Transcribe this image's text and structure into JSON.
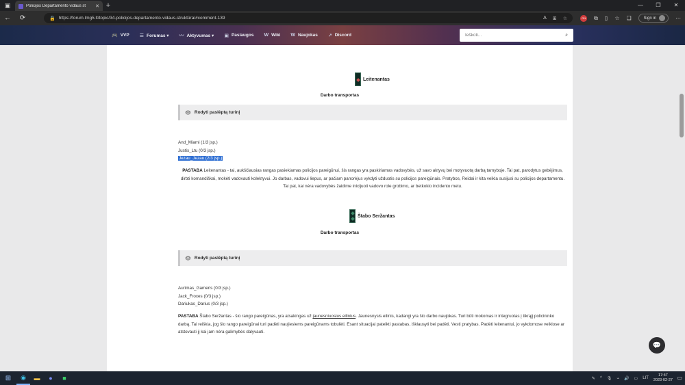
{
  "browser": {
    "tab_title": "Policijos Departamento vidaus st",
    "url": "https://forum.lmg5.lt/topic/34-policijos-departamento-vidaus-struktūra/#comment-139",
    "sign_in_label": "Sign in"
  },
  "nav": {
    "items": [
      {
        "icon": "gamepad-icon",
        "label": "VVP"
      },
      {
        "icon": "list-icon",
        "label": "Forumas ▾"
      },
      {
        "icon": "pulse-icon",
        "label": "Aktyvumas ▾"
      },
      {
        "icon": "tag-icon",
        "label": "Paslaugos"
      },
      {
        "icon": "wiki-icon",
        "label": "Wiki"
      },
      {
        "icon": "news-icon",
        "label": "Naujokas"
      },
      {
        "icon": "discord-icon",
        "label": "Discord"
      }
    ],
    "search_placeholder": "Ieškoti..."
  },
  "sections": [
    {
      "rank": "Leitenantas",
      "subtitle": "Darbo transportas",
      "spoiler_label": "Rodyti paslėptą turinį",
      "members": [
        "And_Miami (1/3 jsp.)",
        "Justis_Ltu (0/3 jsp.)",
        "Jezau_Jezau (2/3 jsp.)"
      ],
      "note_label": "PASTABA",
      "note_text": " Leitenantas - tai, aukščiausias rangas pasiekiamas policijos pareigūnui, šis rangas yra paskiriamas vadovybės, už savo aktyvų bei motyvuotą darbą tarnyboje. Tai pat, parodytus gebėjimus, dirbti komandiškai, mokėti vadovauti kolektyvui. Jo darbas, vadovui liepus, ar pačiam panorėjus vykdyti užduotis su policijos pareigūnais. Pratybos, Reidai ir kita veikla susijusi su policijos departamentu. Tai pat, kai nėra vadovybės žaidime inicijuoti vadovo role grobimo, ar betkokio incidento metu."
    },
    {
      "rank": "Štabo Seržantas",
      "subtitle": "Darbo transportas",
      "spoiler_label": "Rodyti paslėptą turinį",
      "members": [
        "Aurimas_Gameris (0/3 jsp.)",
        "Jack_Froxes (0/3 jsp.)",
        "Dariukas_Darius (0/3 jsp.)"
      ],
      "note_label": "PASTABA",
      "note_pre": " Štabo Seržantas - šio rango pareigūnas, yra atsakingas už ",
      "note_link": "jaunesniuosius eilinius",
      "note_post": ". Jaunesnysis eilinis, kadangi yra šio darbo naujokas. Turi būti mokomas ir integruotas į tikrąjį policininko darbą. Tai reiškia, jog šio rango pareigūnai turi padėti naujiesiems pareigūnams tobulėti. Esant situacijai pateikti pastabas, išklausyti bei padėti. Vesti pratybas. Padėti leitenantui, jo vykdomose veiklose ar atstovauti jį kai jam nėra galimybės dalyvauti."
    }
  ],
  "taskbar": {
    "language": "LIT",
    "time": "17:47",
    "date": "2023-02-27"
  }
}
